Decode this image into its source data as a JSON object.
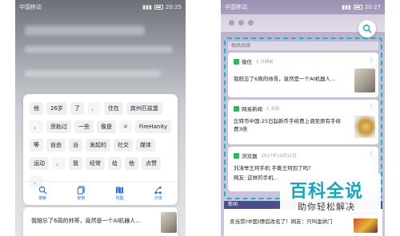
{
  "left_phone": {
    "status_bar": {
      "carrier": "中国移动",
      "time": "20:25"
    },
    "text_chips": [
      "他",
      "26岁",
      "了",
      "，",
      "住在",
      "宾州匹兹堡",
      "。",
      "资助过",
      "一些",
      "像是",
      "#",
      "FireHanity",
      "等",
      "自由",
      "派",
      "发起的",
      "社交",
      "媒体",
      "运动",
      "。",
      "我",
      "经常",
      "给",
      "他",
      "点赞",
      "。"
    ],
    "toolbar": [
      {
        "icon": "search-icon",
        "label": "搜索"
      },
      {
        "icon": "copy-icon",
        "label": "复制"
      },
      {
        "icon": "map-icon",
        "label": "地图"
      },
      {
        "icon": "share-icon",
        "label": "分享"
      }
    ],
    "bottom_news": "我赔忘了6周的帅哥，竟然是一个AI机器人..."
  },
  "right_phone": {
    "status_bar": {
      "carrier": "中国移动",
      "time": "20:27"
    },
    "feed_header": "相关阅读",
    "cards": [
      {
        "app": "微信",
        "time": "1 分钟前",
        "title": "我赔忘了6周的帅哥，竟然是一个AI机器人..."
      },
      {
        "app": "网易新闻",
        "time": "1 天前",
        "title": "比特币中国:25日起新币手续费上调至原有手续费3倍"
      },
      {
        "app": "浏览器",
        "time": "2017年10月11日",
        "title": "刘涛举王珂手机 手撕王珂到了吗？",
        "subtitle": "网友: 这样的手机..."
      }
    ],
    "news_header": "新闻",
    "news_item": "卖当劳(中国)情侣改名了！网友：只叫金拱门"
  },
  "watermark": {
    "line1": "百科全说",
    "line2": "助你轻松解决"
  }
}
